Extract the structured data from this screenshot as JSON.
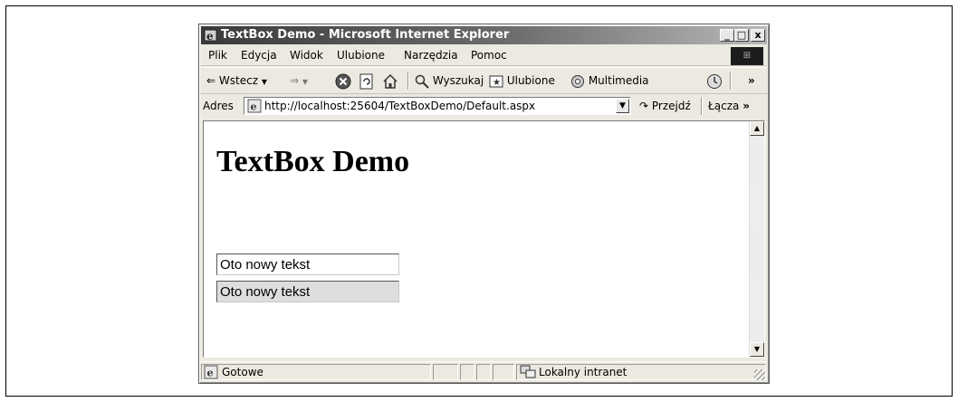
{
  "window": {
    "title": "TextBox Demo - Microsoft Internet Explorer",
    "minimize": "_",
    "maximize": "□",
    "close": "x"
  },
  "menu": [
    "Plik",
    "Edycja",
    "Widok",
    "Ulubione",
    "Narzędzia",
    "Pomoc"
  ],
  "toolbar": {
    "back_label": "Wstecz",
    "search_label": "Wyszukaj",
    "favorites_label": "Ulubione",
    "media_label": "Multimedia",
    "more": "»"
  },
  "address": {
    "label": "Adres",
    "url": "http://localhost:25604/TextBoxDemo/Default.aspx",
    "go_label": "Przejdź",
    "links_label": "Łącza",
    "more": "»"
  },
  "page": {
    "heading": "TextBox Demo",
    "textbox1_value": "Oto nowy tekst",
    "textbox2_value": "Oto nowy tekst"
  },
  "status": {
    "text": "Gotowe",
    "zone": "Lokalny intranet"
  }
}
